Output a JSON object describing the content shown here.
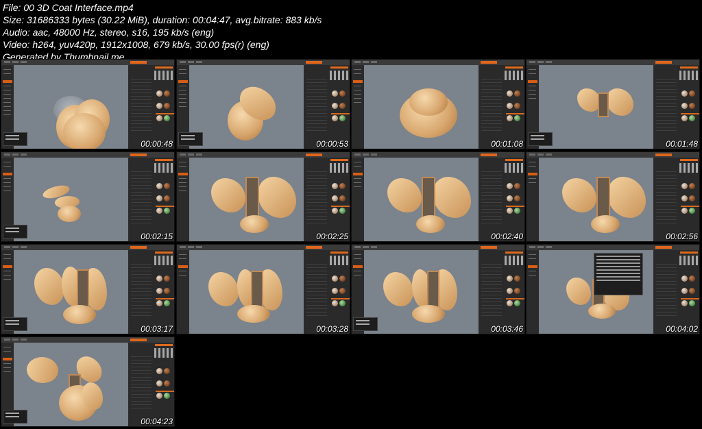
{
  "header": {
    "file_line": "File: 00 3D Coat Interface.mp4",
    "size_line": "Size: 31686333 bytes (30.22 MiB), duration: 00:04:47, avg.bitrate: 883 kb/s",
    "audio_line": "Audio: aac, 48000 Hz, stereo, s16, 195 kb/s (eng)",
    "video_line": "Video: h264, yuv420p, 1912x1008, 679 kb/s, 30.00 fps(r) (eng)",
    "generated_line": "Generated by Thumbnail me"
  },
  "thumbnails": [
    {
      "timestamp": "00:00:48"
    },
    {
      "timestamp": "00:00:53"
    },
    {
      "timestamp": "00:01:08"
    },
    {
      "timestamp": "00:01:48"
    },
    {
      "timestamp": "00:02:15"
    },
    {
      "timestamp": "00:02:25"
    },
    {
      "timestamp": "00:02:40"
    },
    {
      "timestamp": "00:02:56"
    },
    {
      "timestamp": "00:03:17"
    },
    {
      "timestamp": "00:03:28"
    },
    {
      "timestamp": "00:03:46"
    },
    {
      "timestamp": "00:04:02"
    },
    {
      "timestamp": "00:04:23"
    }
  ],
  "colors": {
    "background": "#000000",
    "viewport": "#7b838c",
    "accent": "#e0661c",
    "clay": "#e2b883"
  }
}
